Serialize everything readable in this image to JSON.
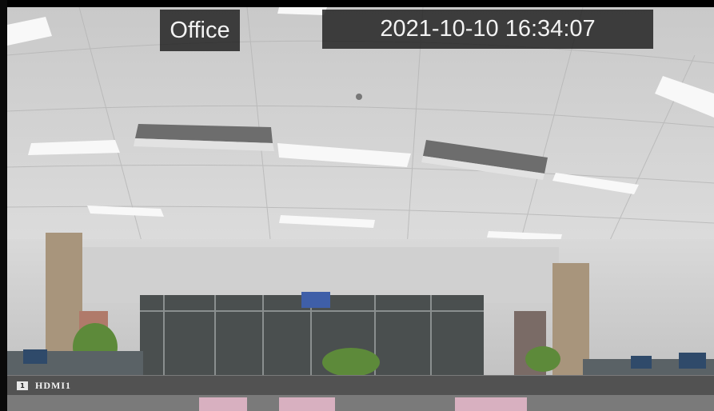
{
  "osd": {
    "camera_name": "Office",
    "timestamp": "2021-10-10 16:34:07"
  },
  "status_strip": {
    "channel_number": "1",
    "output_name": "HDMI1"
  },
  "video": {
    "scene": "office-interior-camera-feed"
  }
}
